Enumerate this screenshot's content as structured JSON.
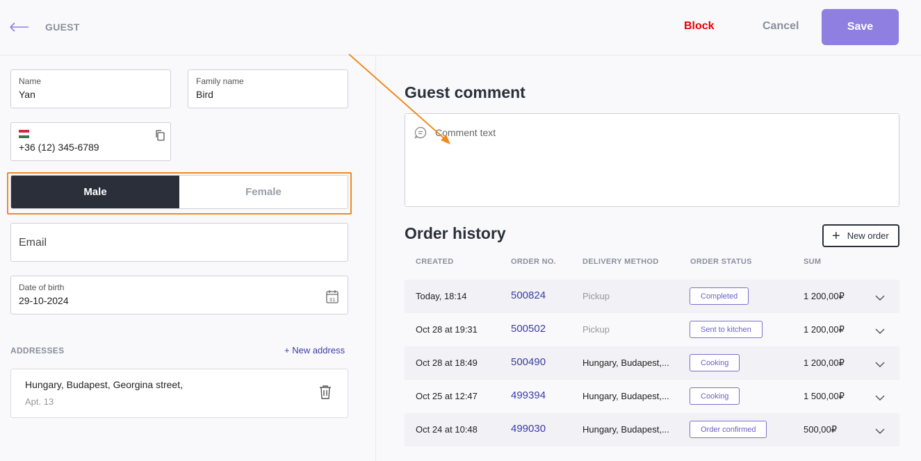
{
  "header": {
    "title": "GUEST",
    "block_label": "Block",
    "cancel_label": "Cancel",
    "save_label": "Save"
  },
  "form": {
    "name": {
      "label": "Name",
      "value": "Yan"
    },
    "family_name": {
      "label": "Family name",
      "value": "Bird"
    },
    "phone": {
      "value": "+36 (12) 345-6789",
      "flag": "hungary-flag-icon"
    },
    "gender": {
      "male": "Male",
      "female": "Female",
      "selected": "Male"
    },
    "email": {
      "placeholder": "Email"
    },
    "birth": {
      "label": "Date of birth",
      "value": "29-10-2024"
    }
  },
  "addresses": {
    "title": "ADDRESSES",
    "new_label": "+ New address",
    "items": [
      {
        "line1": "Hungary, Budapest, Georgina street,",
        "line2": "Apt. 13"
      }
    ]
  },
  "comment": {
    "title": "Guest comment",
    "placeholder": "Comment text"
  },
  "orders": {
    "title": "Order history",
    "new_label": "New order",
    "columns": [
      "CREATED",
      "ORDER NO.",
      "DELIVERY METHOD",
      "ORDER STATUS",
      "SUM"
    ],
    "rows": [
      {
        "created": "Today, 18:14",
        "no": "500824",
        "delivery": "Pickup",
        "status": "Completed",
        "sum": "1 200,00₽"
      },
      {
        "created": "Oct 28 at 19:31",
        "no": "500502",
        "delivery": "Pickup",
        "status": "Sent to kitchen",
        "sum": "1 200,00₽"
      },
      {
        "created": "Oct 28 at 18:49",
        "no": "500490",
        "delivery": "Hungary, Budapest,...",
        "status": "Cooking",
        "sum": "1 200,00₽"
      },
      {
        "created": "Oct 25 at 12:47",
        "no": "499394",
        "delivery": "Hungary, Budapest,...",
        "status": "Cooking",
        "sum": "1 500,00₽"
      },
      {
        "created": "Oct 24 at 10:48",
        "no": "499030",
        "delivery": "Hungary, Budapest,...",
        "status": "Order confirmed",
        "sum": "500,00₽"
      }
    ]
  },
  "colors": {
    "accent": "#8e7fe0",
    "block": "#e60000",
    "link": "#3b3ba8",
    "highlight": "#f08a1d",
    "dark": "#2a2f3a"
  }
}
